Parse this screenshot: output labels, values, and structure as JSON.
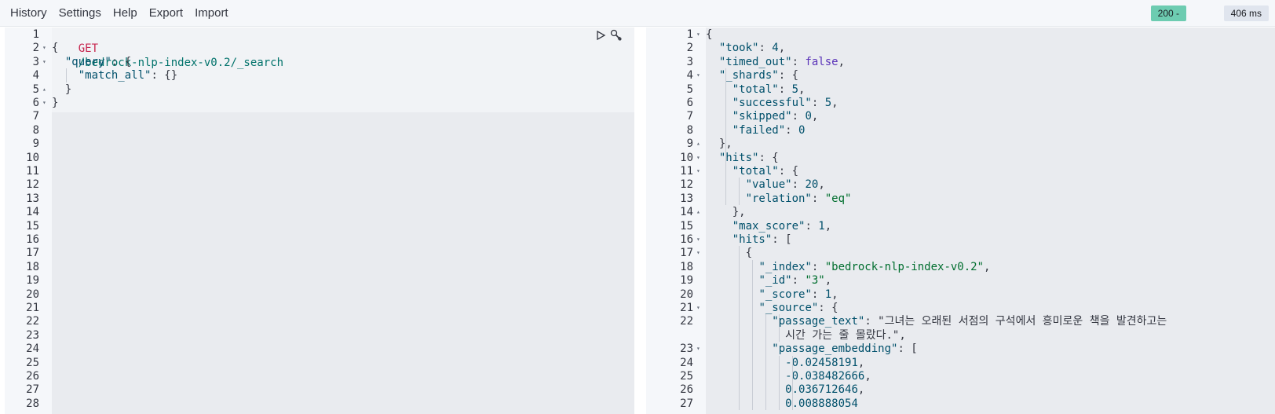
{
  "menu": {
    "items": [
      "History",
      "Settings",
      "Help",
      "Export",
      "Import"
    ]
  },
  "status": {
    "code": "200 -",
    "time": "406 ms"
  },
  "colors": {
    "status_bg": "#6dccb1",
    "time_bg": "#e0e5ee",
    "method": "#c7254e",
    "string": "#006e2e"
  },
  "request": {
    "method": "GET",
    "url": "/bedrock-nlp-index-v0.2/_search",
    "lines": [
      "{",
      "  \"query\": {",
      "    \"match_all\": {}",
      "  }",
      "}"
    ],
    "line_count": 28
  },
  "response": {
    "lines": [
      {
        "n": "1",
        "t": "{"
      },
      {
        "n": "2",
        "t": "  \"took\": 4,"
      },
      {
        "n": "3",
        "t": "  \"timed_out\": false,"
      },
      {
        "n": "4",
        "t": "  \"_shards\": {"
      },
      {
        "n": "5",
        "t": "    \"total\": 5,"
      },
      {
        "n": "6",
        "t": "    \"successful\": 5,"
      },
      {
        "n": "7",
        "t": "    \"skipped\": 0,"
      },
      {
        "n": "8",
        "t": "    \"failed\": 0"
      },
      {
        "n": "9",
        "t": "  },"
      },
      {
        "n": "10",
        "t": "  \"hits\": {"
      },
      {
        "n": "11",
        "t": "    \"total\": {"
      },
      {
        "n": "12",
        "t": "      \"value\": 20,"
      },
      {
        "n": "13",
        "t": "      \"relation\": \"eq\""
      },
      {
        "n": "14",
        "t": "    },"
      },
      {
        "n": "15",
        "t": "    \"max_score\": 1,"
      },
      {
        "n": "16",
        "t": "    \"hits\": ["
      },
      {
        "n": "17",
        "t": "      {"
      },
      {
        "n": "18",
        "t": "        \"_index\": \"bedrock-nlp-index-v0.2\","
      },
      {
        "n": "19",
        "t": "        \"_id\": \"3\","
      },
      {
        "n": "20",
        "t": "        \"_score\": 1,"
      },
      {
        "n": "21",
        "t": "        \"_source\": {"
      },
      {
        "n": "22",
        "t": "          \"passage_text\": \"그녀는 오래된 서점의 구석에서 흥미로운 책을 발견하고는"
      },
      {
        "n": "",
        "t": "            시간 가는 줄 몰랐다.\","
      },
      {
        "n": "23",
        "t": "          \"passage_embedding\": ["
      },
      {
        "n": "24",
        "t": "            -0.02458191,"
      },
      {
        "n": "25",
        "t": "            -0.038482666,"
      },
      {
        "n": "26",
        "t": "            0.036712646,"
      },
      {
        "n": "27",
        "t": "            0.008888054"
      }
    ]
  }
}
